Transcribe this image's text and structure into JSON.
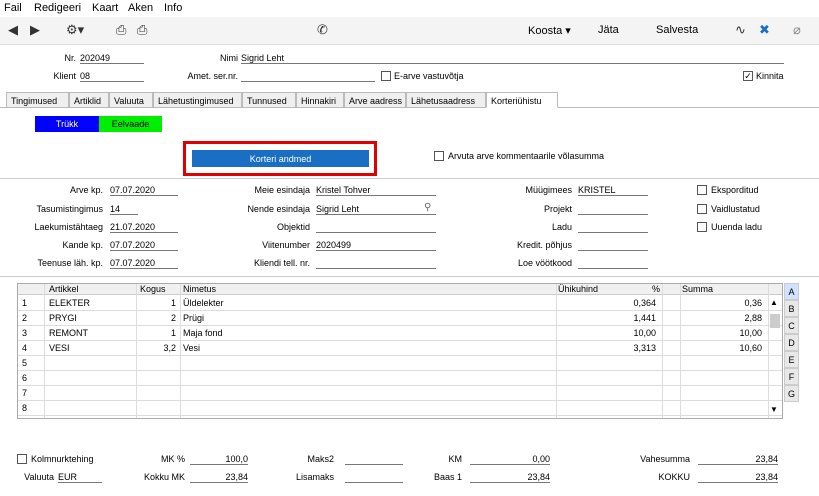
{
  "menu": {
    "items": [
      "Fail",
      "Redigeeri",
      "Kaart",
      "Aken",
      "Info"
    ]
  },
  "toolbar": {
    "koosta": "Koosta",
    "jata": "Jäta",
    "salvesta": "Salvesta"
  },
  "header": {
    "nr_label": "Nr.",
    "nr_value": "202049",
    "nimi_label": "Nimi",
    "nimi_value": "Sigrid Leht",
    "klient_label": "Klient",
    "klient_value": "08",
    "amet_label": "Amet. ser.nr.",
    "amet_value": "",
    "earve_label": "E-arve vastuvõtja",
    "kinnita_label": "Kinnita"
  },
  "tabs": [
    "Tingimused",
    "Artiklid",
    "Valuuta",
    "Lähetustingimused",
    "Tunnused",
    "Hinnakiri",
    "Arve aadress",
    "Lähetusaadress",
    "Korteriühistu"
  ],
  "buttons": {
    "trukk": "Trükk",
    "eelvaade": "Eelvaade",
    "korteri": "Korteri andmed"
  },
  "arvuta_label": "Arvuta arve kommentaarile võlasumma",
  "form": {
    "col1": [
      {
        "label": "Arve kp.",
        "value": "07.07.2020"
      },
      {
        "label": "Tasumistingimus",
        "value": "14"
      },
      {
        "label": "Laekumistähtaeg",
        "value": "21.07.2020"
      },
      {
        "label": "Kande kp.",
        "value": "07.07.2020"
      },
      {
        "label": "Teenuse läh. kp.",
        "value": "07.07.2020"
      }
    ],
    "col2": [
      {
        "label": "Meie esindaja",
        "value": "Kristel Tohver"
      },
      {
        "label": "Nende esindaja",
        "value": "Sigrid Leht"
      },
      {
        "label": "Objektid",
        "value": ""
      },
      {
        "label": "Viitenumber",
        "value": "2020499"
      },
      {
        "label": "Kliendi tell. nr.",
        "value": ""
      }
    ],
    "col3": [
      {
        "label": "Müügimees",
        "value": "KRISTEL"
      },
      {
        "label": "Projekt",
        "value": ""
      },
      {
        "label": "Ladu",
        "value": ""
      },
      {
        "label": "Kredit. põhjus",
        "value": ""
      },
      {
        "label": "Loe vöötkood",
        "value": ""
      }
    ],
    "checks": [
      "Eksporditud",
      "Vaidlustatud",
      "Uuenda ladu"
    ]
  },
  "grid": {
    "headers": {
      "artikkel": "Artikkel",
      "kogus": "Kogus",
      "nimetus": "Nimetus",
      "uhikuhind": "Ühikuhind",
      "pct": "%",
      "summa": "Summa"
    },
    "rows": [
      {
        "n": "1",
        "artikkel": "ELEKTER",
        "kogus": "1",
        "nimetus": "Üldelekter",
        "hind": "0,364",
        "pct": "",
        "summa": "0,36"
      },
      {
        "n": "2",
        "artikkel": "PRYGI",
        "kogus": "2",
        "nimetus": "Prügi",
        "hind": "1,441",
        "pct": "",
        "summa": "2,88"
      },
      {
        "n": "3",
        "artikkel": "REMONT",
        "kogus": "1",
        "nimetus": "Maja fond",
        "hind": "10,00",
        "pct": "",
        "summa": "10,00"
      },
      {
        "n": "4",
        "artikkel": "VESI",
        "kogus": "3,2",
        "nimetus": "Vesi",
        "hind": "3,313",
        "pct": "",
        "summa": "10,60"
      },
      {
        "n": "5",
        "artikkel": "",
        "kogus": "",
        "nimetus": "",
        "hind": "",
        "pct": "",
        "summa": ""
      },
      {
        "n": "6",
        "artikkel": "",
        "kogus": "",
        "nimetus": "",
        "hind": "",
        "pct": "",
        "summa": ""
      },
      {
        "n": "7",
        "artikkel": "",
        "kogus": "",
        "nimetus": "",
        "hind": "",
        "pct": "",
        "summa": ""
      },
      {
        "n": "8",
        "artikkel": "",
        "kogus": "",
        "nimetus": "",
        "hind": "",
        "pct": "",
        "summa": ""
      }
    ],
    "letters": [
      "A",
      "B",
      "C",
      "D",
      "E",
      "F",
      "G"
    ]
  },
  "footer": {
    "kolmnurk_label": "Kolmnurktehing",
    "valuuta_label": "Valuuta",
    "valuuta_value": "EUR",
    "mk_label": "MK %",
    "mk_value": "100,0",
    "kokkumk_label": "Kokku MK",
    "kokkumk_value": "23,84",
    "maks2_label": "Maks2",
    "maks2_value": "",
    "lisamaks_label": "Lisamaks",
    "lisamaks_value": "",
    "km_label": "KM",
    "km_value": "0,00",
    "baas_label": "Baas 1",
    "baas_value": "23,84",
    "vahesumma_label": "Vahesumma",
    "vahesumma_value": "23,84",
    "kokku_label": "KOKKU",
    "kokku_value": "23,84"
  },
  "colors": {
    "trukk_bg": "#0000ff",
    "eelvaade_bg": "#00ee00",
    "korteri_bg": "#1a6fc4",
    "highlight": "#e00000"
  }
}
